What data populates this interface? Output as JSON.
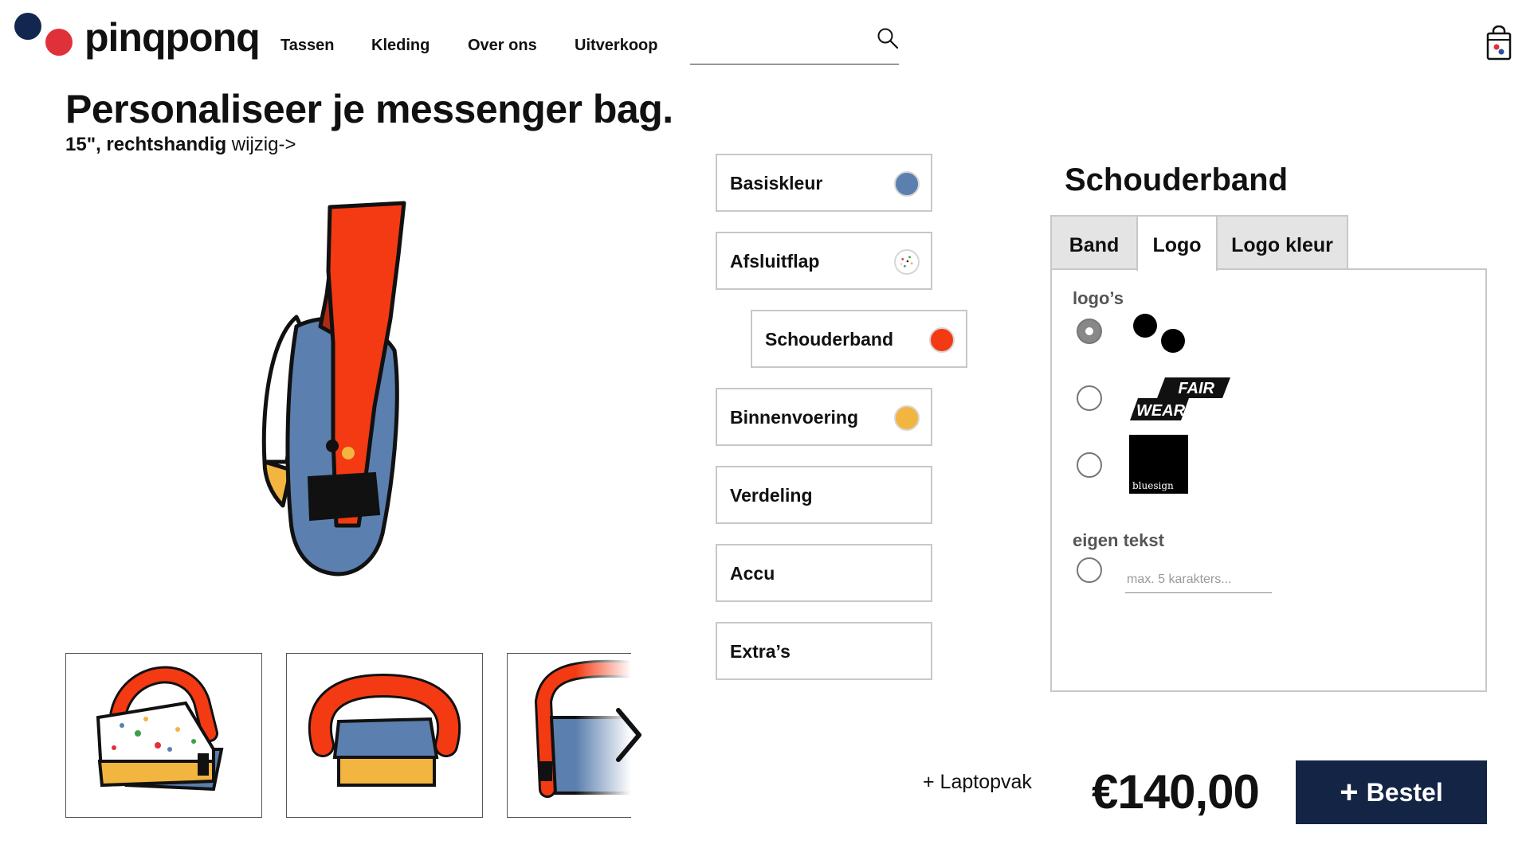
{
  "brand": {
    "name": "pinqponq",
    "dot_colors": [
      "#122650",
      "#e0303a"
    ]
  },
  "nav": {
    "items": [
      {
        "label": "Tassen"
      },
      {
        "label": "Kleding"
      },
      {
        "label": "Over ons"
      },
      {
        "label": "Uitverkoop"
      }
    ]
  },
  "search": {
    "value": "",
    "icon": "search-icon"
  },
  "cart": {
    "icon": "shopping-bag-icon"
  },
  "page": {
    "title": "Personaliseer je messenger bag.",
    "config_bold": "15\", rechtshandig",
    "change_link": "wijzig->"
  },
  "gallery": {
    "next_icon": "chevron-right-icon"
  },
  "options": [
    {
      "label": "Basiskleur",
      "swatch": "#5b7fae",
      "swatch_type": "color"
    },
    {
      "label": "Afsluitflap",
      "swatch": "#ffffff",
      "swatch_type": "pattern"
    },
    {
      "label": "Schouderband",
      "swatch": "#f33a13",
      "swatch_type": "color",
      "selected": true
    },
    {
      "label": "Binnenvoering",
      "swatch": "#f2b540",
      "swatch_type": "color"
    },
    {
      "label": "Verdeling"
    },
    {
      "label": "Accu"
    },
    {
      "label": "Extra’s"
    }
  ],
  "panel": {
    "heading": "Schouderband",
    "tabs": [
      {
        "label": "Band"
      },
      {
        "label": "Logo",
        "active": true
      },
      {
        "label": "Logo kleur"
      }
    ],
    "logos_label": "logo’s",
    "logos": [
      {
        "name": "pinqponq-dots",
        "checked": true
      },
      {
        "name": "fair-wear",
        "text_top": "FAIR",
        "text_bottom": "WEAR",
        "checked": false
      },
      {
        "name": "bluesign",
        "text": "bluesign",
        "checked": false
      }
    ],
    "custom_text_label": "eigen tekst",
    "custom_text_placeholder": "max. 5 karakters..."
  },
  "footer": {
    "addon": "+ Laptopvak",
    "price": "€140,00",
    "order_plus": "+",
    "order_label": "Bestel"
  },
  "colors": {
    "accent_navy": "#142444",
    "strap_red": "#f33a13",
    "base_blue": "#5b7fae",
    "lining_yellow": "#f2b540"
  }
}
